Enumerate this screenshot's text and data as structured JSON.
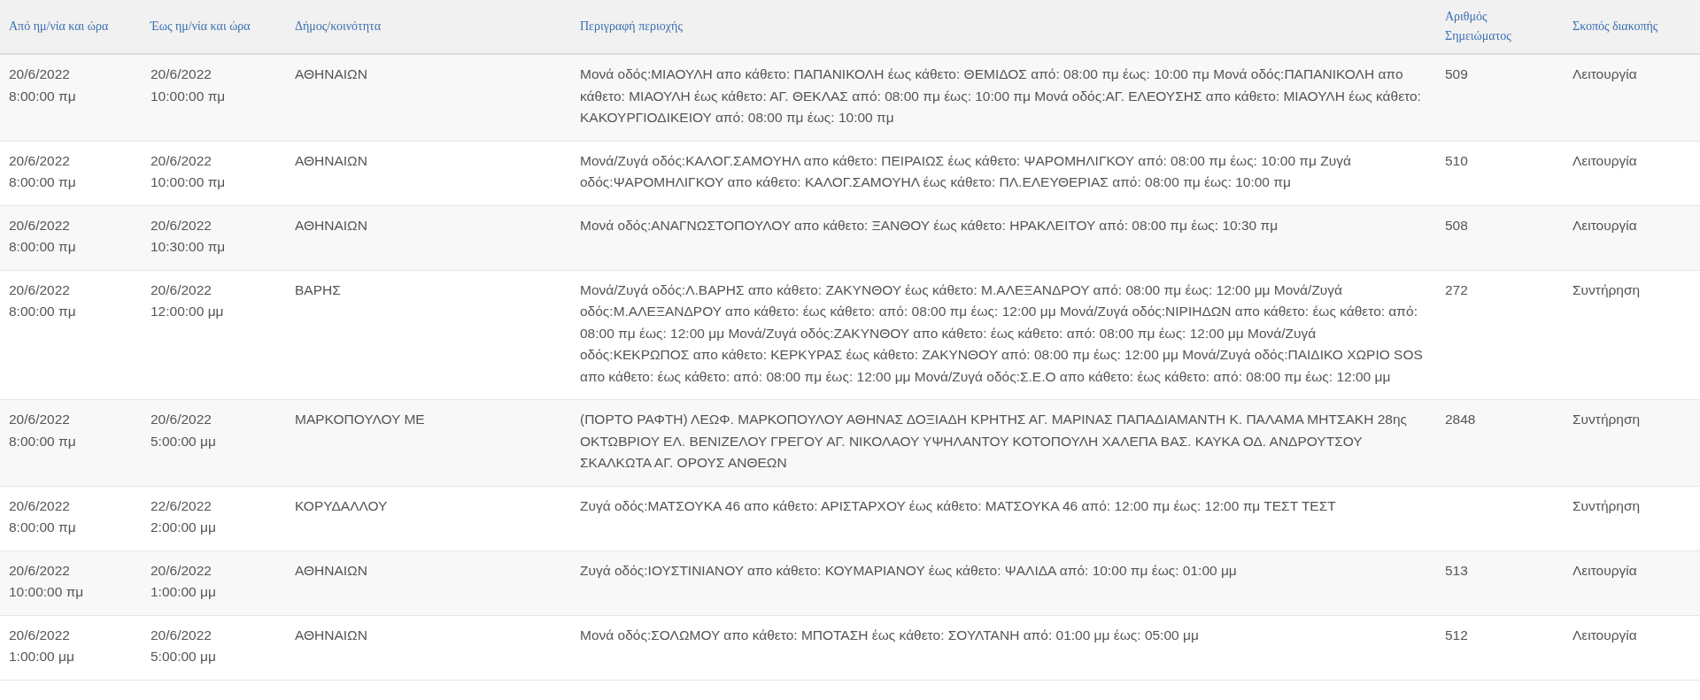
{
  "table": {
    "columns": [
      "Από ημ/νία και ώρα",
      "Έως ημ/νία και ώρα",
      "Δήμος/κοινότητα",
      "Περιγραφή περιοχής",
      "Αριθμός Σημειώματος",
      "Σκοπός διακοπής"
    ],
    "rows": [
      {
        "from": "20/6/2022 8:00:00 πμ",
        "to": "20/6/2022 10:00:00 πμ",
        "municipality": "ΑΘΗΝΑΙΩΝ",
        "description": "Μονά οδός:ΜΙΑΟΥΛΗ απο κάθετο: ΠΑΠΑΝΙΚΟΛΗ έως κάθετο: ΘΕΜΙΔΟΣ από: 08:00 πμ έως: 10:00 πμ Μονά οδός:ΠΑΠΑΝΙΚΟΛΗ απο κάθετο: ΜΙΑΟΥΛΗ έως κάθετο: ΑΓ. ΘΕΚΛΑΣ από: 08:00 πμ έως: 10:00 πμ Μονά οδός:ΑΓ. ΕΛΕΟΥΣΗΣ απο κάθετο: ΜΙΑΟΥΛΗ έως κάθετο: ΚΑΚΟΥΡΓΙΟΔΙΚΕΙΟΥ από: 08:00 πμ έως: 10:00 πμ",
        "note_number": "509",
        "purpose": "Λειτουργία"
      },
      {
        "from": "20/6/2022 8:00:00 πμ",
        "to": "20/6/2022 10:00:00 πμ",
        "municipality": "ΑΘΗΝΑΙΩΝ",
        "description": "Μονά/Ζυγά οδός:ΚΑΛΟΓ.ΣΑΜΟΥΗΛ απο κάθετο: ΠΕΙΡΑΙΩΣ έως κάθετο: ΨΑΡΟΜΗΛΙΓΚΟΥ από: 08:00 πμ έως: 10:00 πμ Ζυγά οδός:ΨΑΡΟΜΗΛΙΓΚΟΥ απο κάθετο: ΚΑΛΟΓ.ΣΑΜΟΥΗΛ έως κάθετο: ΠΛ.ΕΛΕΥΘΕΡΙΑΣ από: 08:00 πμ έως: 10:00 πμ",
        "note_number": "510",
        "purpose": "Λειτουργία"
      },
      {
        "from": "20/6/2022 8:00:00 πμ",
        "to": "20/6/2022 10:30:00 πμ",
        "municipality": "ΑΘΗΝΑΙΩΝ",
        "description": "Μονά οδός:ΑΝΑΓΝΩΣΤΟΠΟΥΛΟΥ απο κάθετο: ΞΑΝΘΟΥ έως κάθετο: ΗΡΑΚΛΕΙΤΟΥ από: 08:00 πμ έως: 10:30 πμ",
        "note_number": "508",
        "purpose": "Λειτουργία"
      },
      {
        "from": "20/6/2022 8:00:00 πμ",
        "to": "20/6/2022 12:00:00 μμ",
        "municipality": "ΒΑΡΗΣ",
        "description": "Μονά/Ζυγά οδός:Λ.ΒΑΡΗΣ απο κάθετο: ΖΑΚΥΝΘΟΥ έως κάθετο: Μ.ΑΛΕΞΑΝΔΡΟΥ από: 08:00 πμ έως: 12:00 μμ Μονά/Ζυγά οδός:Μ.ΑΛΕΞΑΝΔΡΟΥ απο κάθετο: έως κάθετο: από: 08:00 πμ έως: 12:00 μμ Μονά/Ζυγά οδός:ΝΙΡΙΗΔΩΝ απο κάθετο: έως κάθετο: από: 08:00 πμ έως: 12:00 μμ Μονά/Ζυγά οδός:ΖΑΚΥΝΘΟΥ απο κάθετο: έως κάθετο: από: 08:00 πμ έως: 12:00 μμ Μονά/Ζυγά οδός:ΚΕΚΡΩΠΟΣ απο κάθετο: ΚΕΡΚΥΡΑΣ έως κάθετο: ΖΑΚΥΝΘΟΥ από: 08:00 πμ έως: 12:00 μμ Μονά/Ζυγά οδός:ΠΑΙΔΙΚΟ ΧΩΡΙΟ SOS απο κάθετο: έως κάθετο: από: 08:00 πμ έως: 12:00 μμ Μονά/Ζυγά οδός:Σ.Ε.Ο απο κάθετο: έως κάθετο: από: 08:00 πμ έως: 12:00 μμ",
        "note_number": "272",
        "purpose": "Συντήρηση"
      },
      {
        "from": "20/6/2022 8:00:00 πμ",
        "to": "20/6/2022 5:00:00 μμ",
        "municipality": "ΜΑΡΚΟΠΟΥΛΟΥ ΜΕ",
        "description": "(ΠΟΡΤΟ ΡΑΦΤΗ) ΛΕΩΦ. ΜΑΡΚΟΠΟΥΛΟΥ ΑΘΗΝΑΣ ΔΟΞΙΑΔΗ ΚΡΗΤΗΣ ΑΓ. ΜΑΡΙΝΑΣ ΠΑΠΑΔΙΑΜΑΝΤΗ Κ. ΠΑΛΑΜΑ ΜΗΤΣΑΚΗ 28ης ΟΚΤΩΒΡΙΟΥ ΕΛ. ΒΕΝΙΖΕΛΟΥ ΓΡΕΓΟΥ ΑΓ. ΝΙΚΟΛΑΟΥ ΥΨΗΛΑΝΤΟΥ ΚΟΤΟΠΟΥΛΗ ΧΑΛΕΠΑ ΒΑΣ. ΚΑΥΚΑ ΟΔ. ΑΝΔΡΟΥΤΣΟΥ ΣΚΑΛΚΩΤΑ ΑΓ. ΟΡΟΥΣ ΑΝΘΕΩΝ",
        "note_number": "2848",
        "purpose": "Συντήρηση"
      },
      {
        "from": "20/6/2022 8:00:00 πμ",
        "to": "22/6/2022 2:00:00 μμ",
        "municipality": "ΚΟΡΥΔΑΛΛΟΥ",
        "description": "Ζυγά οδός:ΜΑΤΣΟΥΚΑ 46 απο κάθετο: ΑΡΙΣΤΑΡΧΟΥ έως κάθετο: ΜΑΤΣΟΥΚΑ 46 από: 12:00 πμ έως: 12:00 πμ ΤΕΣΤ ΤΕΣΤ",
        "purpose": "Συντήρηση"
      },
      {
        "from": "20/6/2022 10:00:00 πμ",
        "to": "20/6/2022 1:00:00 μμ",
        "municipality": "ΑΘΗΝΑΙΩΝ",
        "description": "Ζυγά οδός:ΙΟΥΣΤΙΝΙΑΝΟΥ απο κάθετο: ΚΟΥΜΑΡΙΑΝΟΥ έως κάθετο: ΨΑΛΙΔΑ από: 10:00 πμ έως: 01:00 μμ",
        "note_number": "513",
        "purpose": "Λειτουργία"
      },
      {
        "from": "20/6/2022 1:00:00 μμ",
        "to": "20/6/2022 5:00:00 μμ",
        "municipality": "ΑΘΗΝΑΙΩΝ",
        "description": "Μονά οδός:ΣΟΛΩΜΟΥ απο κάθετο: ΜΠΟΤΑΣΗ έως κάθετο: ΣΟΥΛΤΑΝΗ από: 01:00 μμ έως: 05:00 μμ",
        "note_number": "512",
        "purpose": "Λειτουργία"
      }
    ]
  }
}
